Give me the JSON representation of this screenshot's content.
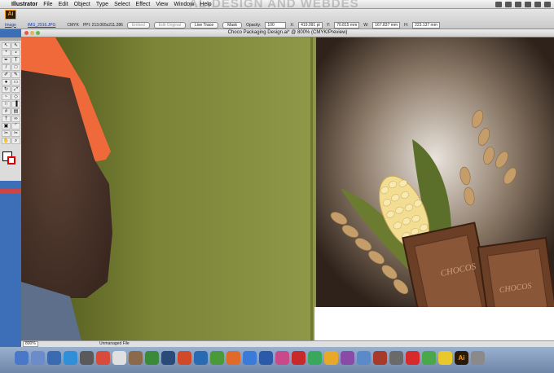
{
  "menubar": {
    "apple": "",
    "app_name": "Illustrator",
    "items": [
      "File",
      "Edit",
      "Object",
      "Type",
      "Select",
      "Effect",
      "View",
      "Window",
      "Help"
    ],
    "watermark": "AL-DESIGN AND WEBDES"
  },
  "control_bar": {
    "logo": "Ai",
    "object_type": "Image",
    "file_link": "IMG_2916.JPG",
    "color_mode": "CMYK",
    "ppi": "PPI: 213.065x211.286",
    "embed_label": "Embed",
    "edit_original_label": "Edit Original",
    "live_trace_label": "Live Trace",
    "mask_label": "Mask",
    "opacity_label": "Opacity:",
    "opacity_value": "100",
    "x_label": "X:",
    "x_value": "419.091 pt",
    "y_label": "Y:",
    "y_value": "70.815 mm",
    "w_label": "W:",
    "w_value": "167.837 mm",
    "h_label": "H:",
    "h_value": "223.137 mm"
  },
  "document": {
    "title": "Choco Packaging Design.ai* @ 800% (CMYK/Preview)"
  },
  "artwork": {
    "choco_label_1": "CHOCOS",
    "choco_label_2": "CHOCOS"
  },
  "status": {
    "zoom": "800%",
    "state": "Unmanaged File"
  },
  "colors": {
    "canvas_green": "#8c9546",
    "tool_stroke": "#d00000",
    "ai_brand": "#f7a21b"
  }
}
